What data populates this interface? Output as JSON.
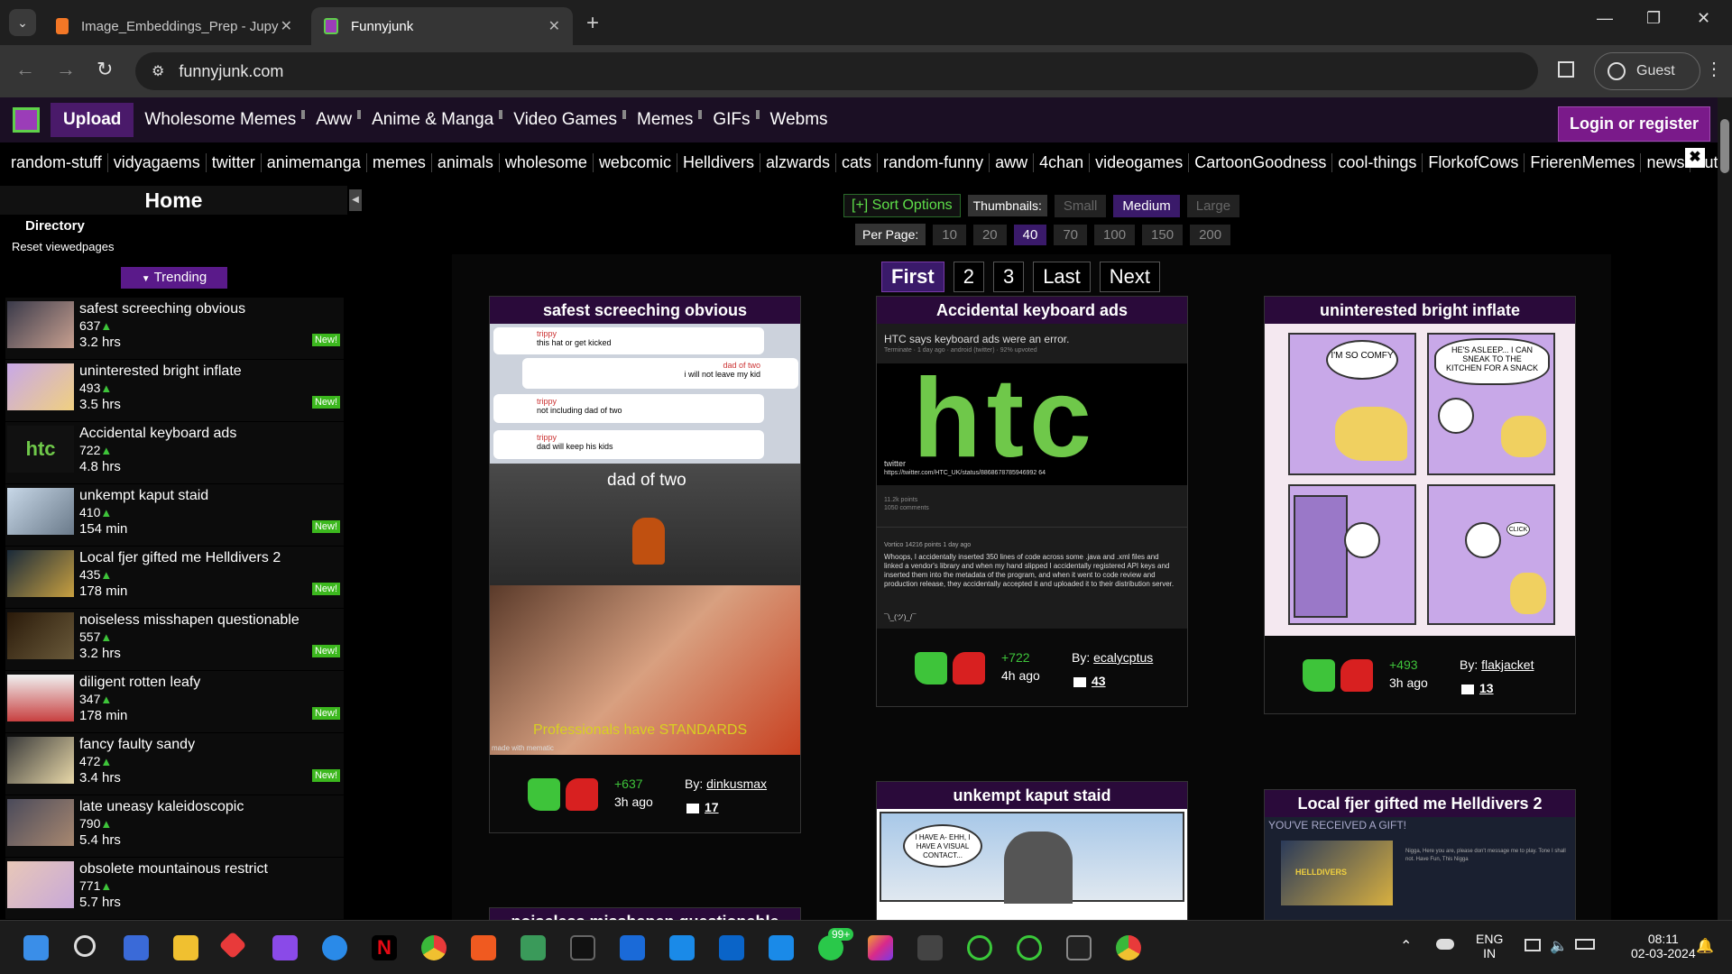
{
  "browser": {
    "tabs": [
      {
        "title": "Image_Embeddings_Prep - Jupy",
        "active": false
      },
      {
        "title": "Funnyjunk",
        "active": true
      }
    ],
    "url": "funnyjunk.com",
    "profile": "Guest"
  },
  "site": {
    "upload": "Upload",
    "topnav": [
      "Wholesome Memes",
      "Aww",
      "Anime & Manga",
      "Video Games",
      "Memes",
      "GIFs",
      "Webms"
    ],
    "login": "Login or register",
    "categories": [
      "random-stuff",
      "vidyagaems",
      "twitter",
      "animemanga",
      "memes",
      "animals",
      "wholesome",
      "webcomic",
      "Helldivers",
      "alzwards",
      "cats",
      "random-funny",
      "aww",
      "4chan",
      "videogames",
      "CartoonGoodness",
      "cool-things",
      "FlorkofCows",
      "FrierenMemes",
      "news",
      "cute"
    ]
  },
  "sidebar": {
    "home": "Home",
    "directory": "Directory",
    "reset": "Reset viewedpages",
    "trending": "Trending",
    "items": [
      {
        "title": "safest screeching obvious",
        "votes": "637",
        "time": "3.2 hrs",
        "new": "New!"
      },
      {
        "title": "uninterested bright inflate",
        "votes": "493",
        "time": "3.5 hrs",
        "new": "New!"
      },
      {
        "title": "Accidental keyboard ads",
        "votes": "722",
        "time": "4.8 hrs",
        "new": ""
      },
      {
        "title": "unkempt kaput staid",
        "votes": "410",
        "time": "154 min",
        "new": "New!"
      },
      {
        "title": "Local fjer gifted me Helldivers 2",
        "votes": "435",
        "time": "178 min",
        "new": "New!"
      },
      {
        "title": "noiseless misshapen questionable",
        "votes": "557",
        "time": "3.2 hrs",
        "new": "New!"
      },
      {
        "title": "diligent rotten leafy",
        "votes": "347",
        "time": "178 min",
        "new": "New!"
      },
      {
        "title": "fancy faulty sandy",
        "votes": "472",
        "time": "3.4 hrs",
        "new": "New!"
      },
      {
        "title": "late uneasy kaleidoscopic",
        "votes": "790",
        "time": "5.4 hrs",
        "new": ""
      },
      {
        "title": "obsolete mountainous restrict",
        "votes": "771",
        "time": "5.7 hrs",
        "new": ""
      }
    ]
  },
  "controls": {
    "sort": "[+] Sort Options",
    "thumbnails_label": "Thumbnails:",
    "sizes": [
      "Small",
      "Medium",
      "Large"
    ],
    "selected_size": "Medium",
    "per_page_label": "Per Page:",
    "per_page": [
      "10",
      "20",
      "40",
      "70",
      "100",
      "150",
      "200"
    ],
    "selected_per_page": "40",
    "pager": [
      "First",
      "2",
      "3",
      "Last",
      "Next"
    ]
  },
  "cards": [
    {
      "title": "safest screeching obvious",
      "score": "+637",
      "ago": "3h ago",
      "by_label": "By:",
      "author": "dinkusmax",
      "comments": "17",
      "img_text": {
        "l1": "trippy",
        "l2": "this hat or get kicked",
        "l3": "dad of two",
        "l4": "i will not leave my kid",
        "l5": "trippy",
        "l6": "not including dad of two",
        "l7": "trippy",
        "l8": "dad will keep his kids",
        "cap": "dad of two",
        "tf2": "Professionals have STANDARDS",
        "wm": "made with mematic"
      }
    },
    {
      "title": "Accidental keyboard ads",
      "score": "+722",
      "ago": "4h ago",
      "by_label": "By:",
      "author": "ecalycptus",
      "comments": "43",
      "img_text": {
        "head": "HTC says keyboard ads were an error.",
        "sub": "Terminate · 1 day ago · android (twitter) · 92% upvoted",
        "logo": "htc",
        "tw": "twitter",
        "link": "https://twitter.com/HTC_UK/status/8868678785946992 64",
        "pts": "11.2k points",
        "cmts": "1050 comments",
        "user": "Vortico 14216 points 1 day ago",
        "body": "Whoops, I accidentally inserted 350 lines of code across some .java and .xml files and linked a vendor's library and when my hand slipped I accidentally registered API keys and inserted them into the metadata of the program, and when it went to code review and production release, they accidentally accepted it and uploaded it to their distribution server.",
        "shrug": "¯\\_(ツ)_/¯"
      }
    },
    {
      "title": "uninterested bright inflate",
      "score": "+493",
      "ago": "3h ago",
      "by_label": "By:",
      "author": "flakjacket",
      "comments": "13",
      "img_text": {
        "b1": "I'M SO COMFY",
        "b2": "HE'S ASLEEP... I CAN SNEAK TO THE KITCHEN FOR A SNACK",
        "b3": "CLICK"
      }
    },
    {
      "title": "unkempt kaput staid",
      "img_text": {
        "b1": "I HAVE A- EHH, I HAVE A VISUAL CONTACT..."
      }
    },
    {
      "title": "Local fjer gifted me Helldivers 2",
      "img_text": {
        "head": "YOU'VE RECEIVED A GIFT!",
        "game": "HELLDIVERS",
        "msg": "Nigga, Here you are, please don't message me to play. Tone I shall not. Have Fun, This Nigga"
      }
    },
    {
      "title": "noiseless misshapen questionable"
    }
  ],
  "taskbar": {
    "lang1": "ENG",
    "lang2": "IN",
    "time": "08:11",
    "date": "02-03-2024",
    "badge": "99+"
  }
}
